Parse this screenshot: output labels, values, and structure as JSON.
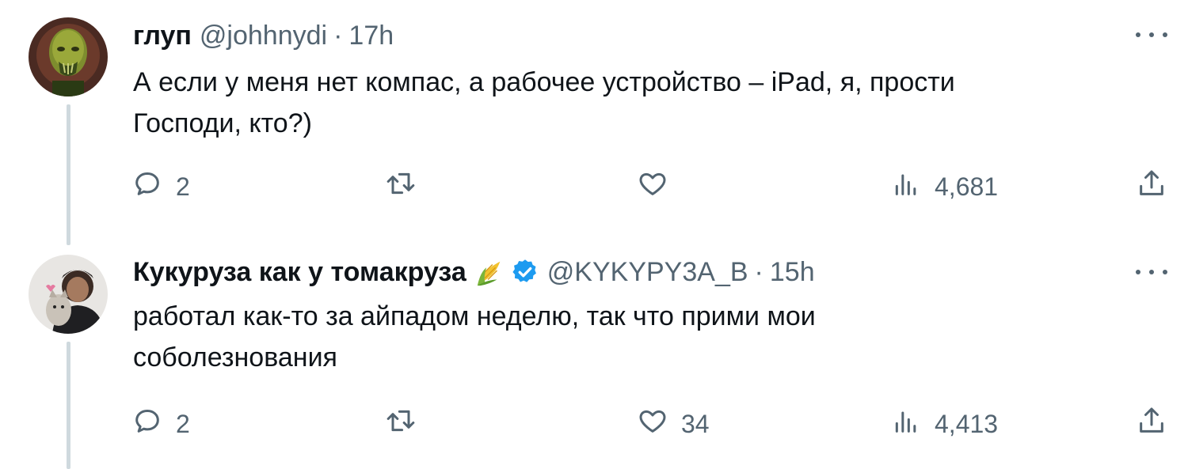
{
  "tweets": [
    {
      "name": "глуп",
      "handle": "@johhnydi",
      "separator": "·",
      "time": "17h",
      "text_line1": "А если у меня нет компас, а рабочее устройство – iPad, я, прости",
      "text_line2": "Господи, кто?)",
      "replies": "2",
      "retweets": "",
      "likes": "",
      "views": "4,681"
    },
    {
      "name": "Кукуруза как у томакруза",
      "handle": "@KYKYPY3A_B",
      "separator": "·",
      "time": "15h",
      "text_line1": "работал как-то за айпадом неделю, так что прими мои",
      "text_line2": "соболезнования",
      "replies": "2",
      "retweets": "",
      "likes": "34",
      "views": "4,413",
      "emoji_icon": "corn-emoji-icon",
      "verified_color": "#1d9bf0"
    }
  ],
  "colors": {
    "text": "#0f1419",
    "secondary": "#536471",
    "thread_line": "#cfd9de",
    "verified": "#1d9bf0"
  }
}
